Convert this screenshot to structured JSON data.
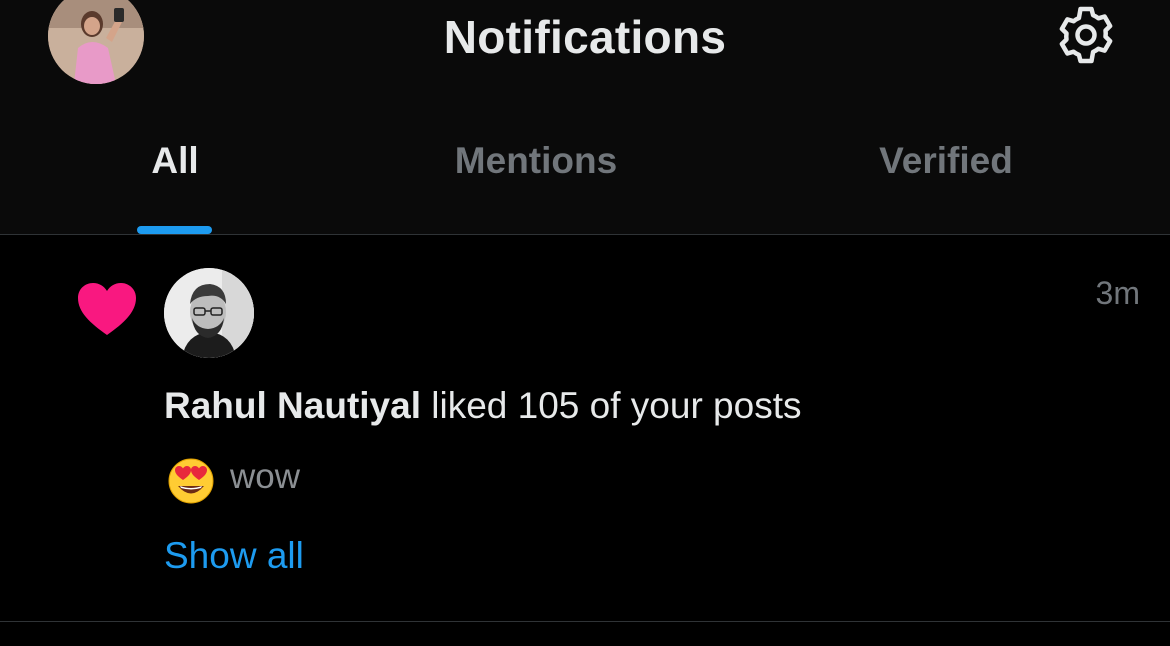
{
  "header": {
    "title": "Notifications",
    "avatar_icon": "profile-avatar",
    "settings_icon": "gear-icon"
  },
  "tabs": [
    {
      "label": "All",
      "active": true
    },
    {
      "label": "Mentions",
      "active": false
    },
    {
      "label": "Verified",
      "active": false
    }
  ],
  "notification": {
    "type_icon": "heart-icon",
    "user_name": "Rahul Nautiyal",
    "action_text": " liked 105 of your posts",
    "time": "3m",
    "reaction_emoji": "heart-eyes-emoji",
    "reaction_text": "wow",
    "show_all_label": "Show all"
  },
  "colors": {
    "accent": "#1d9bf0",
    "like": "#f91880",
    "text_primary": "#e7e9ea",
    "text_secondary": "#71767b",
    "background": "#000000"
  }
}
